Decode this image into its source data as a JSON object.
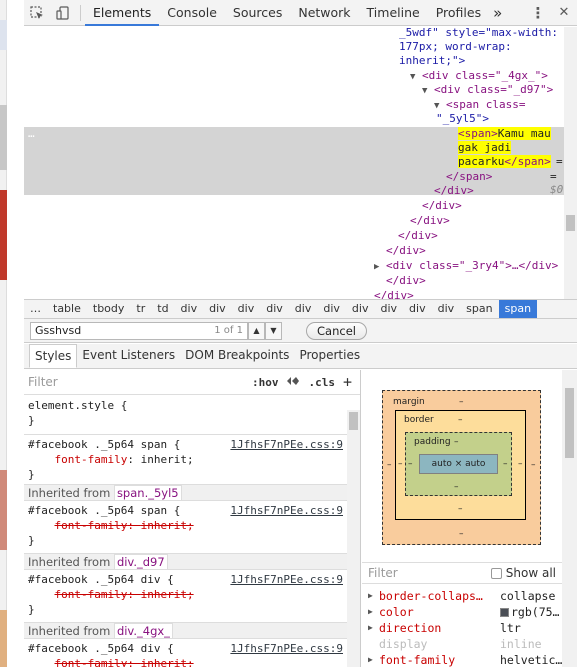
{
  "toolbar": {
    "tabs": [
      "Elements",
      "Console",
      "Sources",
      "Network",
      "Timeline",
      "Profiles"
    ],
    "more": "»",
    "menu": "⋮",
    "close": "✕"
  },
  "dom": {
    "line1": "_5wdf\" style=\"max-width:",
    "line2": "177px; word-wrap:",
    "line3": "inherit;\">",
    "div_4gx_open": "<div class=\"_4gx_\">",
    "div_d97_open": "<div class=\"_d97\">",
    "span_open": "<span class=",
    "span_class": "\"_5yl5\">",
    "ellipsis": "…",
    "inner_span_open": "<span>",
    "inner_text_1": "Kamu mau",
    "inner_text_2": "gak jadi",
    "inner_text_3": "pacarku",
    "inner_span_close": "</span>",
    "eq_sign": "=",
    "dollar0": "$0",
    "span_close": "</span>",
    "div_close": "</div>",
    "div_3ry4": "<div class=\"_3ry4\">…</div>"
  },
  "breadcrumbs": [
    "…",
    "table",
    "tbody",
    "tr",
    "td",
    "div",
    "div",
    "div",
    "div",
    "div",
    "div",
    "div",
    "div",
    "div",
    "div",
    "span",
    "span"
  ],
  "search": {
    "value": "Gsshvsd",
    "count": "1 of 1",
    "up": "▲",
    "down": "▼",
    "cancel": "Cancel"
  },
  "style_tabs": [
    "Styles",
    "Event Listeners",
    "DOM Breakpoints",
    "Properties"
  ],
  "styles": {
    "filter_placeholder": "Filter",
    "hov": ":hov",
    "cls": ".cls",
    "plus": "+",
    "element_style": "element.style {",
    "close_brace": "}",
    "rule1_selector": "#facebook ._5p64 span {",
    "rule1_source": "1JfhsF7nPEe.css:9",
    "prop_font_family": "font-family",
    "prop_value_inherit": "inherit;",
    "inherited_from": "Inherited from",
    "inh1": "span._5yl5",
    "rule2_selector": "#facebook ._5p64 span {",
    "rule2_source": "1JfhsF7nPEe.css:9",
    "inh2": "div._d97",
    "rule3_selector": "#facebook ._5p64 div {",
    "rule3_source": "1JfhsF7nPEe.css:9",
    "inh3": "div._4gx_",
    "rule4_selector": "#facebook ._5p64 div {",
    "rule4_source": "1JfhsF7nPEe.css:9"
  },
  "boxmodel": {
    "margin_label": "margin",
    "border_label": "border",
    "padding_label": "padding",
    "content": "auto × auto",
    "dash": "–"
  },
  "computed": {
    "filter_placeholder": "Filter",
    "show_all": "Show all",
    "props": [
      {
        "name": "border-collaps…",
        "value": "collapse"
      },
      {
        "name": "color",
        "value": "rgb(75…"
      },
      {
        "name": "direction",
        "value": "ltr"
      },
      {
        "name": "display",
        "value": "inline"
      },
      {
        "name": "font-family",
        "value": "helvetic…"
      }
    ]
  },
  "colors": {
    "accent": "#3879d9",
    "highlight": "#ffff00",
    "selected_row": "#d4d4d4",
    "margin_box": "#f9cc9d",
    "border_box": "#fddd9b",
    "padding_box": "#c3d08b",
    "content_box": "#8cb6c0"
  }
}
